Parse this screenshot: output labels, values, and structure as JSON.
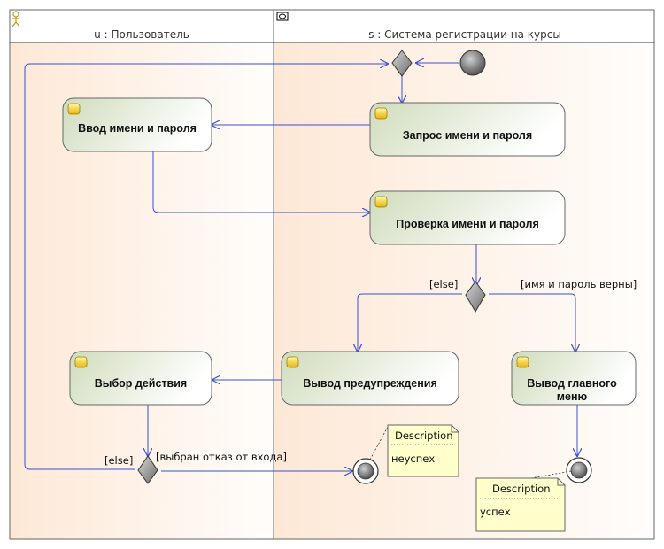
{
  "swimlanes": {
    "user_lane_title": "u : Пользователь",
    "system_lane_title": "s : Система регистрации на курсы"
  },
  "activities": {
    "enter_credentials": "Ввод имени и пароля",
    "request_credentials": "Запрос имени и пароля",
    "check_credentials": "Проверка имени и пароля",
    "choose_action": "Выбор действия",
    "show_warning": "Вывод предупреждения",
    "show_main_menu_line1": "Вывод главного",
    "show_main_menu_line2": "меню"
  },
  "guards": {
    "check_else": "[else]",
    "check_valid": "[имя и пароль верны]",
    "choice_else": "[else]",
    "choice_refused": "[выбран отказ от входа]"
  },
  "notes": {
    "failure": {
      "title": "Description",
      "text": "неуспех"
    },
    "success": {
      "title": "Description",
      "text": "успех"
    }
  },
  "colors": {
    "flow": "#3a4fd0",
    "activity_fill_start": "#d4e0c3",
    "activity_fill_end": "#ffffff",
    "note_fill": "#ffffcc",
    "lane_fill": "#fdf3ea"
  }
}
